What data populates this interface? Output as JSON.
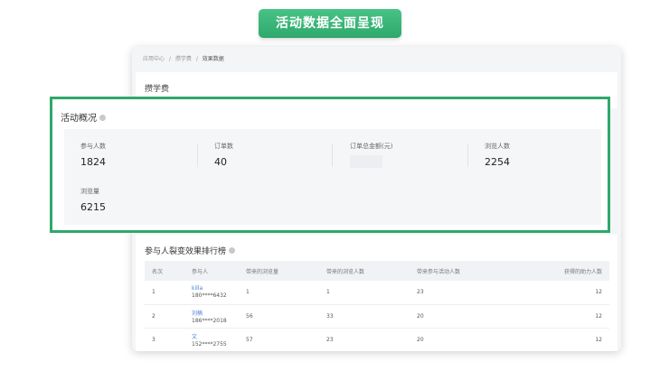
{
  "banner": {
    "text": "活动数据全面呈现"
  },
  "breadcrumb": [
    "应用中心",
    "/",
    "攒学费",
    "/",
    "效果数据"
  ],
  "page": {
    "title": "攒学费"
  },
  "overview": {
    "title": "活动概况",
    "stats": [
      {
        "label": "参与人数",
        "value": "1824"
      },
      {
        "label": "订单数",
        "value": "40"
      },
      {
        "label": "订单总金额(元)",
        "value": ""
      },
      {
        "label": "浏览人数",
        "value": "2254"
      },
      {
        "label": "浏览量",
        "value": "6215"
      }
    ]
  },
  "ranking": {
    "title": "参与人裂变效果排行榜",
    "columns": [
      "名次",
      "参与人",
      "带来的浏览量",
      "带来的浏览人数",
      "带来参与活动人数",
      "获得的助力人数"
    ],
    "rows": [
      {
        "rank": "1",
        "name": "killa",
        "phone": "180****6432",
        "views": "1",
        "visitors": "1",
        "participants": "23",
        "helpers": "12"
      },
      {
        "rank": "2",
        "name": "刘楠",
        "phone": "186****2018",
        "views": "56",
        "visitors": "33",
        "participants": "20",
        "helpers": "12"
      },
      {
        "rank": "3",
        "name": "文",
        "phone": "152****2755",
        "views": "57",
        "visitors": "23",
        "participants": "20",
        "helpers": "12"
      }
    ]
  },
  "colors": {
    "accent": "#2fa86b",
    "link": "#4a7fd6"
  }
}
